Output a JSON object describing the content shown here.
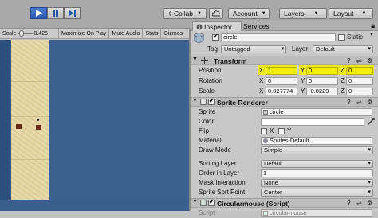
{
  "toolbar": {
    "collab_label": "Collab",
    "account_label": "Account",
    "layers_label": "Layers",
    "layout_label": "Layout"
  },
  "scene_strip": {
    "scale_label": "Scale",
    "scale_value": "0.425",
    "maximize_label": "Maximize On Play",
    "mute_label": "Mute Audio",
    "stats_label": "Stats",
    "gizmos_label": "Gizmos"
  },
  "inspector": {
    "tab_inspector": "Inspector",
    "tab_services": "Services",
    "object_name": "circle",
    "static_label": "Static",
    "tag_label": "Tag",
    "tag_value": "Untagged",
    "layer_label": "Layer",
    "layer_value": "Default"
  },
  "transform": {
    "title": "Transform",
    "position_label": "Position",
    "rotation_label": "Rotation",
    "scale_label": "Scale",
    "x_label": "X",
    "y_label": "Y",
    "z_label": "Z",
    "pos_x": "1",
    "pos_y": "0",
    "pos_z": "0",
    "rot_x": "0",
    "rot_y": "0",
    "rot_z": "0",
    "scale_x": "0.027774",
    "scale_y": "-0.0229",
    "scale_z": "0"
  },
  "sprite_renderer": {
    "title": "Sprite Renderer",
    "sprite_label": "Sprite",
    "sprite_value": "circle",
    "color_label": "Color",
    "flip_label": "Flip",
    "flip_x": "X",
    "flip_y": "Y",
    "material_label": "Material",
    "material_value": "Sprites-Default",
    "draw_mode_label": "Draw Mode",
    "draw_mode_value": "Simple",
    "sorting_layer_label": "Sorting Layer",
    "sorting_layer_value": "Default",
    "order_label": "Order in Layer",
    "order_value": "1",
    "mask_label": "Mask Interaction",
    "mask_value": "None",
    "sort_point_label": "Sprite Sort Point",
    "sort_point_value": "Center"
  },
  "script_component": {
    "title": "Circularmouse (Script)",
    "script_label": "Script",
    "script_value": "circularmouse"
  },
  "colors": {
    "play_active": "#2d5db0",
    "highlight": "#f2f000",
    "game_bg": "#3b5f8f",
    "sand": "#e7d9ab"
  }
}
